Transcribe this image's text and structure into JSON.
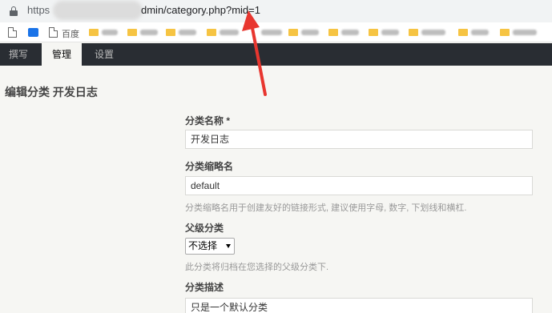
{
  "browser": {
    "url_prefix": "https",
    "url_suffix": "dmin/category.php?mid=1",
    "bookmark_first_label": "百度"
  },
  "nav": {
    "items": [
      {
        "label": "撰写"
      },
      {
        "label": "管理"
      },
      {
        "label": "设置"
      }
    ]
  },
  "page": {
    "title": "编辑分类 开发日志"
  },
  "form": {
    "name_label": "分类名称 *",
    "name_value": "开发日志",
    "slug_label": "分类缩略名",
    "slug_value": "default",
    "slug_hint": "分类缩略名用于创建友好的链接形式, 建议使用字母, 数字, 下划线和横杠.",
    "parent_label": "父级分类",
    "parent_selected": "不选择",
    "parent_hint": "此分类将归档在您选择的父级分类下.",
    "desc_label": "分类描述",
    "desc_value": "只是一个默认分类"
  },
  "colors": {
    "nav_bg": "#292d33",
    "page_bg": "#f6f6f3",
    "annotation": "#e8362f"
  }
}
